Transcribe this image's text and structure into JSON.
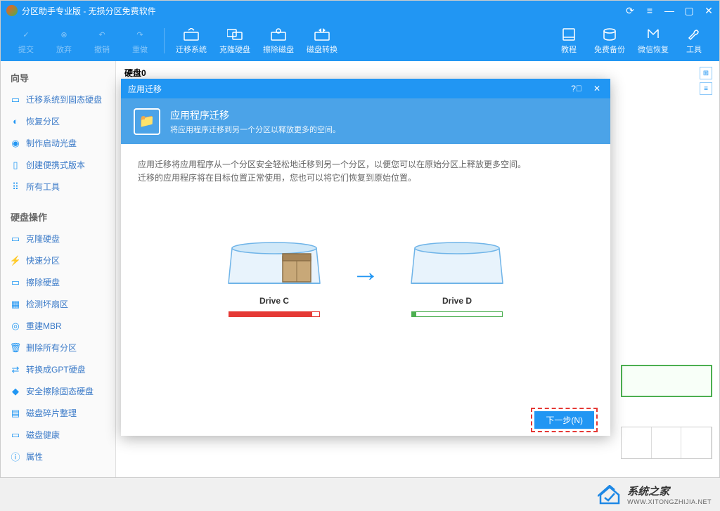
{
  "title": "分区助手专业版 - 无损分区免费软件",
  "toolbar": {
    "submit": "提交",
    "abandon": "放弃",
    "undo": "撤销",
    "redo": "重做",
    "migrate": "迁移系统",
    "clone": "克隆硬盘",
    "erase": "擦除磁盘",
    "convert": "磁盘转换",
    "tutorial": "教程",
    "backup": "免费备份",
    "wechat": "微信恢复",
    "tools": "工具"
  },
  "sidebar": {
    "wizard_title": "向导",
    "wizard_items": [
      "迁移系统到固态硬盘",
      "恢复分区",
      "制作启动光盘",
      "创建便携式版本",
      "所有工具"
    ],
    "disk_title": "硬盘操作",
    "disk_items": [
      "克隆硬盘",
      "快速分区",
      "擦除硬盘",
      "检测坏扇区",
      "重建MBR",
      "删除所有分区",
      "转换成GPT硬盘",
      "安全擦除固态硬盘",
      "磁盘碎片整理",
      "磁盘健康",
      "属性"
    ]
  },
  "content": {
    "disk_label": "硬盘0"
  },
  "modal": {
    "title": "应用迁移",
    "header_title": "应用程序迁移",
    "header_sub": "将应用程序迁移到另一个分区以释放更多的空间。",
    "desc_line1": "应用迁移将应用程序从一个分区安全轻松地迁移到另一个分区，以便您可以在原始分区上释放更多空间。",
    "desc_line2": "迁移的应用程序将在目标位置正常使用，您也可以将它们恢复到原始位置。",
    "drive_c": "Drive C",
    "drive_d": "Drive D",
    "next_btn": "下一步(N)"
  },
  "watermark": {
    "cn": "系统之家",
    "en": "WWW.XITONGZHIJIA.NET"
  }
}
